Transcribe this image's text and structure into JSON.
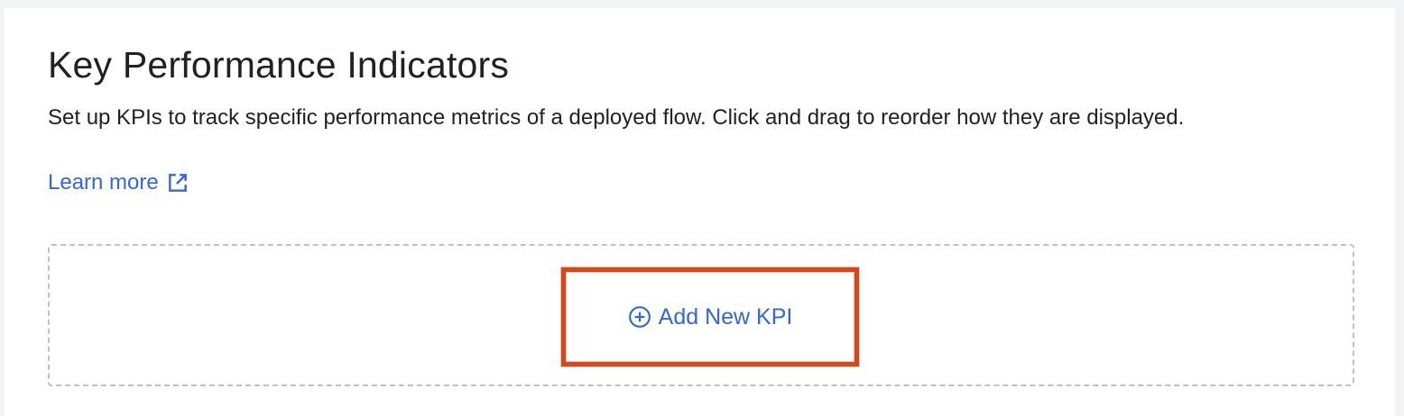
{
  "header": {
    "title": "Key Performance Indicators",
    "description": "Set up KPIs to track specific performance metrics of a deployed flow. Click and drag to reorder how they are displayed.",
    "learn_more_label": "Learn more"
  },
  "dropzone": {
    "add_button_label": "Add New KPI"
  },
  "icons": {
    "learn_more": "open-in-new-icon",
    "add": "add-circle-outline-icon"
  },
  "colors": {
    "link": "#3367d6",
    "text": "#202124",
    "highlight": "#d2491c",
    "border": "#bdc1c6"
  }
}
